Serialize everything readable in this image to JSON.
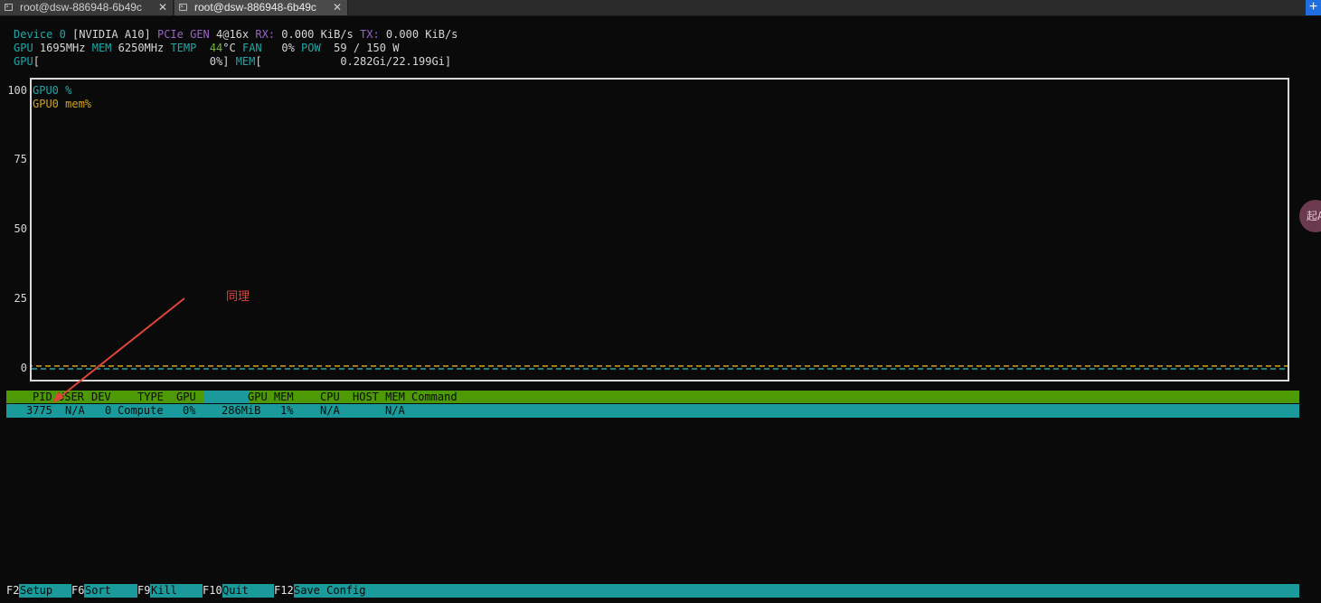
{
  "tabs": [
    {
      "label": "root@dsw-886948-6b49c",
      "active": false
    },
    {
      "label": "root@dsw-886948-6b49c",
      "active": true
    }
  ],
  "new_tab_symbol": "+",
  "close_symbol": "✕",
  "header": {
    "device_label": "Device 0",
    "device_name": "[NVIDIA A10]",
    "pcie_label": "PCIe GEN",
    "pcie_value": "4@16x",
    "rx_label": "RX:",
    "rx_value": "0.000 KiB/s",
    "tx_label": "TX:",
    "tx_value": "0.000 KiB/s",
    "gpu_label": "GPU",
    "gpu_clock": "1695MHz",
    "mem_label": "MEM",
    "mem_clock": "6250MHz",
    "temp_label": "TEMP",
    "temp_value": "44",
    "temp_unit": "°C",
    "fan_label": "FAN",
    "fan_value": "0%",
    "pow_label": "POW",
    "pow_value": "59 / 150 W",
    "gpu_bar_label": "GPU",
    "gpu_bar_value": "0%",
    "mem_bar_label": "MEM",
    "mem_bar_value": "0.282Gi/22.199Gi"
  },
  "chart_data": {
    "type": "line",
    "y_ticks": [
      "100",
      "75",
      "50",
      "25",
      "0"
    ],
    "ylim": [
      0,
      100
    ],
    "series": [
      {
        "name": "GPU0 %",
        "values": [
          0
        ],
        "color": "#1fa8a8"
      },
      {
        "name": "GPU0 mem%",
        "values": [
          1
        ],
        "color": "#d2a21e"
      }
    ]
  },
  "process_table": {
    "columns": [
      "PID",
      "USER",
      "DEV",
      "TYPE",
      "GPU",
      "GPU MEM",
      "CPU",
      "HOST MEM",
      "Command"
    ],
    "rows": [
      {
        "pid": "3775",
        "user": "N/A",
        "dev": "0",
        "type": "Compute",
        "gpu": "0%",
        "gpu_mem": "286MiB",
        "gpu_mem_pct": "1%",
        "cpu": "N/A",
        "host_mem": "N/A",
        "command": ""
      }
    ]
  },
  "footer": [
    {
      "key": "F2",
      "label": "Setup"
    },
    {
      "key": "F6",
      "label": "Sort"
    },
    {
      "key": "F9",
      "label": "Kill"
    },
    {
      "key": "F10",
      "label": "Quit"
    },
    {
      "key": "F12",
      "label": "Save Config"
    }
  ],
  "annotation": {
    "text": "同理",
    "color": "#e0453a"
  },
  "side_bubble_text": "起A"
}
